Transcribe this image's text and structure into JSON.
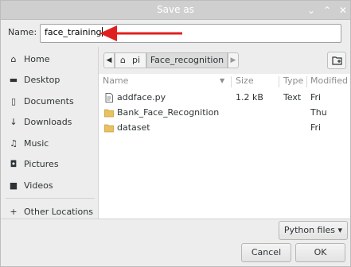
{
  "window": {
    "title": "Save as",
    "minimize_glyph": "⌄",
    "maximize_glyph": "⌃",
    "close_glyph": "✕"
  },
  "name": {
    "label": "Name:",
    "value": "face_training"
  },
  "annotation": {
    "arrow_color": "#e02020"
  },
  "sidebar": {
    "items": [
      {
        "label": "Home",
        "icon": "home-icon",
        "glyph": "⌂"
      },
      {
        "label": "Desktop",
        "icon": "desktop-folder-icon",
        "glyph": "▬"
      },
      {
        "label": "Documents",
        "icon": "document-icon",
        "glyph": "▯"
      },
      {
        "label": "Downloads",
        "icon": "download-arrow-icon",
        "glyph": "↓"
      },
      {
        "label": "Music",
        "icon": "music-note-icon",
        "glyph": "♫"
      },
      {
        "label": "Pictures",
        "icon": "camera-icon",
        "glyph": "◘"
      },
      {
        "label": "Videos",
        "icon": "video-icon",
        "glyph": "■"
      },
      {
        "label": "Other Locations",
        "icon": "plus-icon",
        "glyph": "+"
      }
    ]
  },
  "pathbar": {
    "left_glyph": "◀",
    "home_glyph": "⌂",
    "home_label": "pi",
    "current": "Face_recognition",
    "right_glyph": "▶"
  },
  "columns": {
    "name": "Name",
    "size": "Size",
    "type": "Type",
    "modified": "Modified",
    "sort_glyph": "▼"
  },
  "files": [
    {
      "name": "addface.py",
      "size": "1.2 kB",
      "type": "Text",
      "modified": "Fri",
      "icon": "text-file-icon"
    },
    {
      "name": "Bank_Face_Recognition",
      "size": "",
      "type": "",
      "modified": "Thu",
      "icon": "folder-icon"
    },
    {
      "name": "dataset",
      "size": "",
      "type": "",
      "modified": "Fri",
      "icon": "folder-icon"
    }
  ],
  "colors": {
    "folder": "#e8c160",
    "accent_red": "#e02020"
  },
  "footer": {
    "filter_label": "Python files",
    "filter_glyph": "▾",
    "cancel_label": "Cancel",
    "ok_label": "OK"
  }
}
